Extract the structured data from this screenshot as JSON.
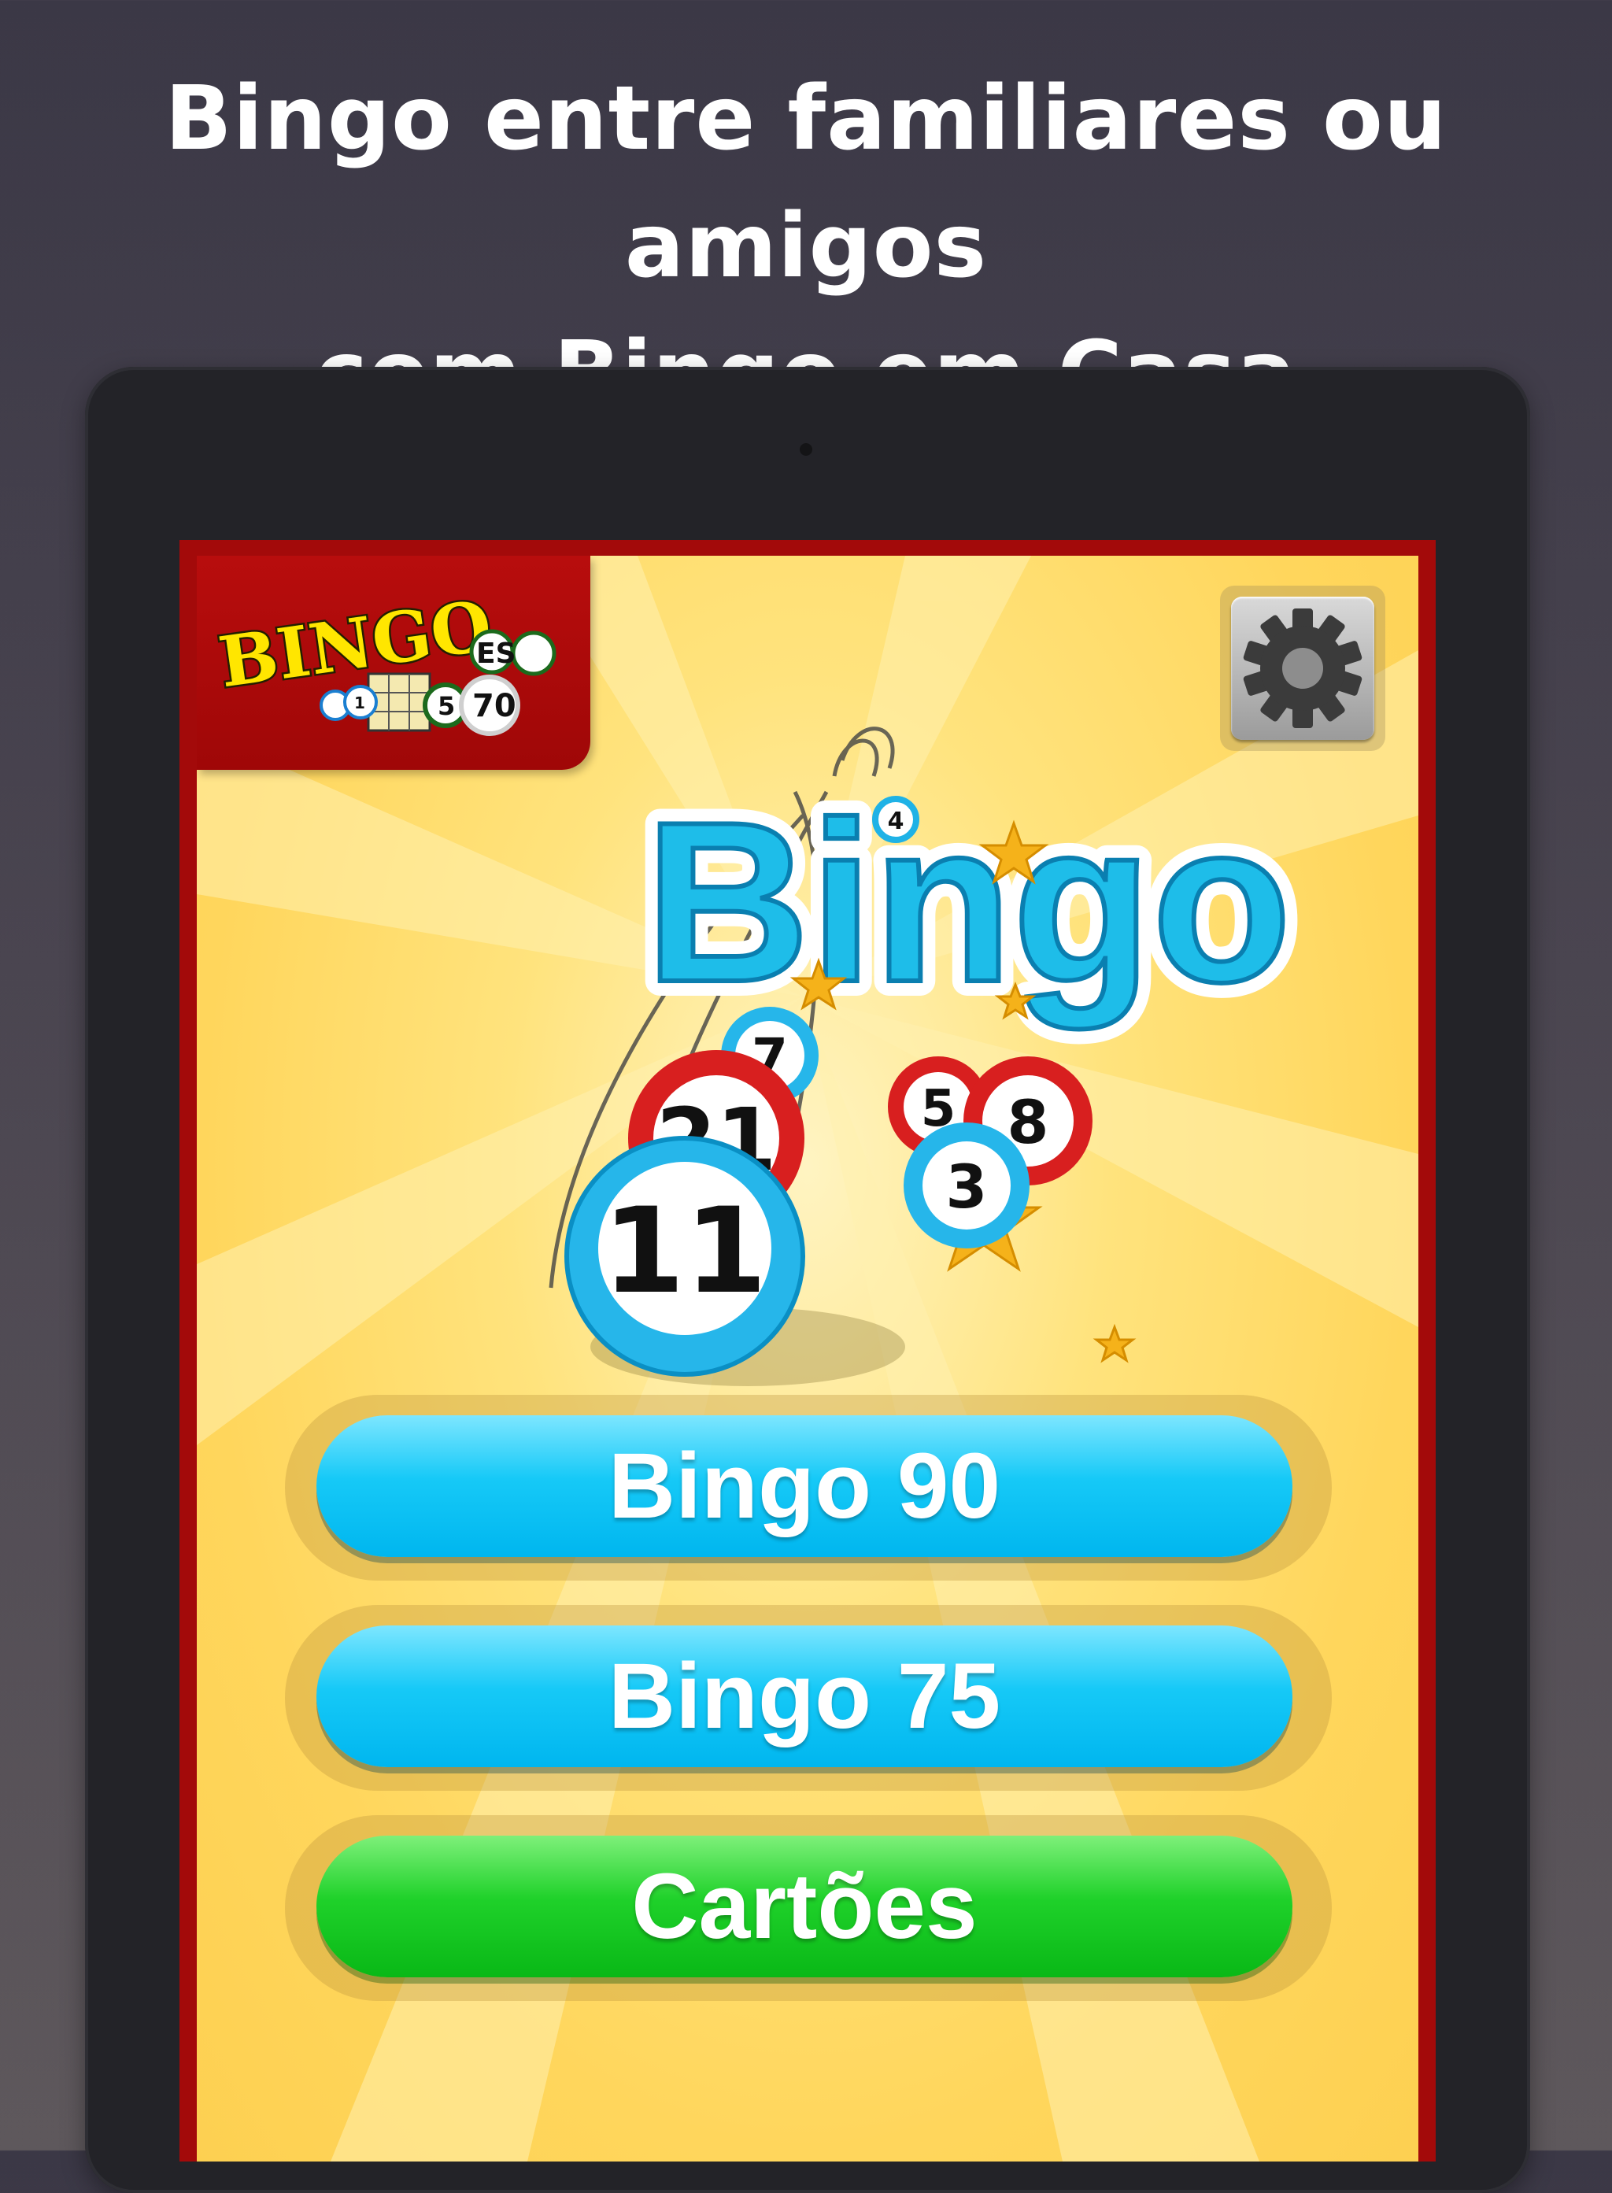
{
  "headline": {
    "line1": "Bingo entre familiares ou amigos",
    "line2": "com Bingo em Casa"
  },
  "app": {
    "logo": {
      "wordmark": "BINGO",
      "suffix": "ES",
      "ball_numbers": [
        "1",
        "5",
        "70"
      ]
    },
    "settings_icon": "gear-icon",
    "hero": {
      "title": "Bingo",
      "balls": [
        "4",
        "7",
        "21",
        "5",
        "8",
        "3",
        "11"
      ]
    },
    "menu": {
      "bingo90_label": "Bingo 90",
      "bingo75_label": "Bingo 75",
      "cartoes_label": "Cartões"
    }
  },
  "colors": {
    "screen_border": "#a30a0a",
    "background_yellow": "#ffd65c",
    "title_blue": "#22c4f0",
    "button_blue": "#16c9f7",
    "button_green": "#1fd12a",
    "star": "#f5b21a"
  }
}
